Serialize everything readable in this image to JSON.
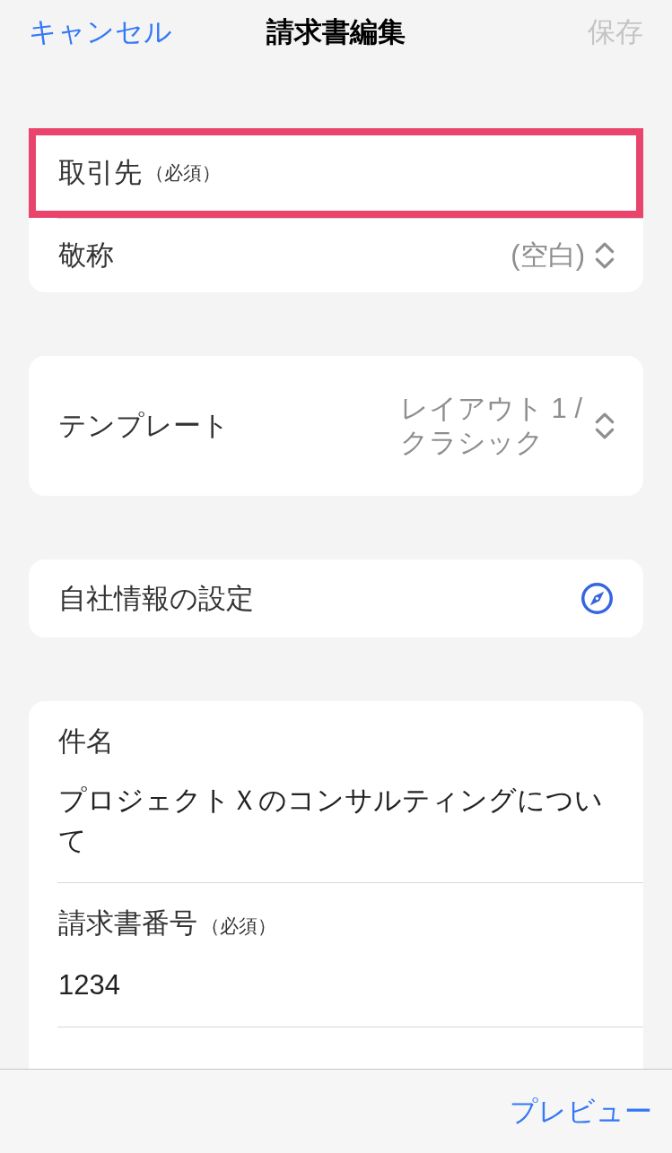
{
  "nav_bar": {
    "cancel": "キャンセル",
    "title": "請求書編集",
    "save": {
      "label": "保存",
      "disabled": true
    }
  },
  "sections": [
    {
      "rows": [
        {
          "kind": "field",
          "label": "取引先",
          "note": "（必須）",
          "highlighted": true
        },
        {
          "kind": "select",
          "label": "敬称",
          "value": "(空白)"
        }
      ]
    },
    {
      "rows": [
        {
          "kind": "picker",
          "label": "テンプレート",
          "value": "レイアウト 1 / クラシック"
        }
      ]
    },
    {
      "rows": [
        {
          "kind": "link",
          "label": "自社情報の設定"
        }
      ]
    },
    {
      "rows": [
        {
          "kind": "text",
          "label": "件名",
          "value": "プロジェクトＸのコンサルティングについて"
        },
        {
          "kind": "text",
          "label": "請求書番号",
          "note": "（必須）",
          "value": "1234"
        }
      ]
    }
  ],
  "toolbar": {
    "preview": "プレビュー"
  }
}
